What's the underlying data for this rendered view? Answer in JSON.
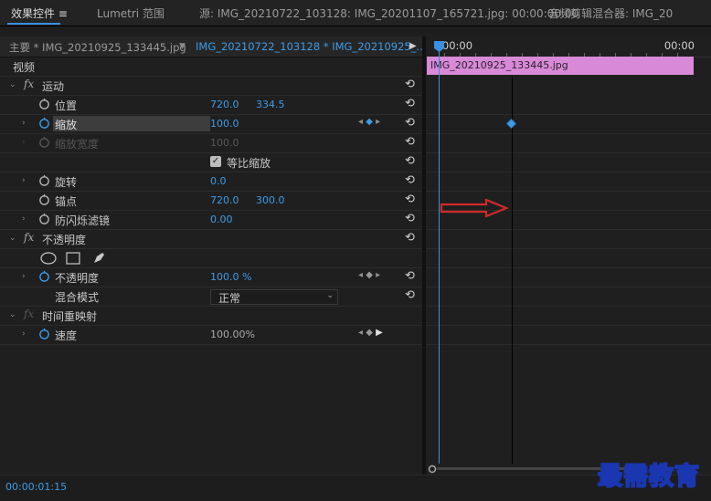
{
  "tabs": [
    {
      "label": "效果控件",
      "menu": "≡"
    },
    {
      "label": "Lumetri 范围"
    },
    {
      "label": "源: IMG_20210722_103128: IMG_20201107_165721.jpg: 00:00:00:00"
    },
    {
      "label": "音频剪辑混合器: IMG_20"
    }
  ],
  "seq": {
    "master": "主要 * IMG_20210925_133445.jpg",
    "current": "IMG_20210722_103128 * IMG_20210925_..."
  },
  "timeline": {
    "time_start": ":00:00",
    "time_end": "00:00",
    "clip_name": "IMG_20210925_133445.jpg"
  },
  "effects": {
    "video_label": "视频",
    "motion": {
      "label": "运动",
      "position": {
        "label": "位置",
        "x": "720.0",
        "y": "334.5"
      },
      "scale": {
        "label": "缩放",
        "value": "100.0"
      },
      "scale_width": {
        "label": "缩放宽度",
        "value": "100.0"
      },
      "uniform": {
        "label": "等比缩放"
      },
      "rotation": {
        "label": "旋转",
        "value": "0.0"
      },
      "anchor": {
        "label": "锚点",
        "x": "720.0",
        "y": "300.0"
      },
      "flicker": {
        "label": "防闪烁滤镜",
        "value": "0.00"
      }
    },
    "opacity": {
      "label": "不透明度",
      "opacity": {
        "label": "不透明度",
        "value": "100.0 %"
      },
      "blend": {
        "label": "混合模式",
        "value": "正常"
      }
    },
    "time_remap": {
      "label": "时间重映射",
      "speed": {
        "label": "速度",
        "value": "100.00%"
      }
    }
  },
  "status": {
    "timecode": "00:00:01:15"
  },
  "watermark": "最需教育",
  "colors": {
    "accent": "#3a8fe0",
    "clip": "#d88ad8",
    "arrow": "#d02a2a"
  }
}
